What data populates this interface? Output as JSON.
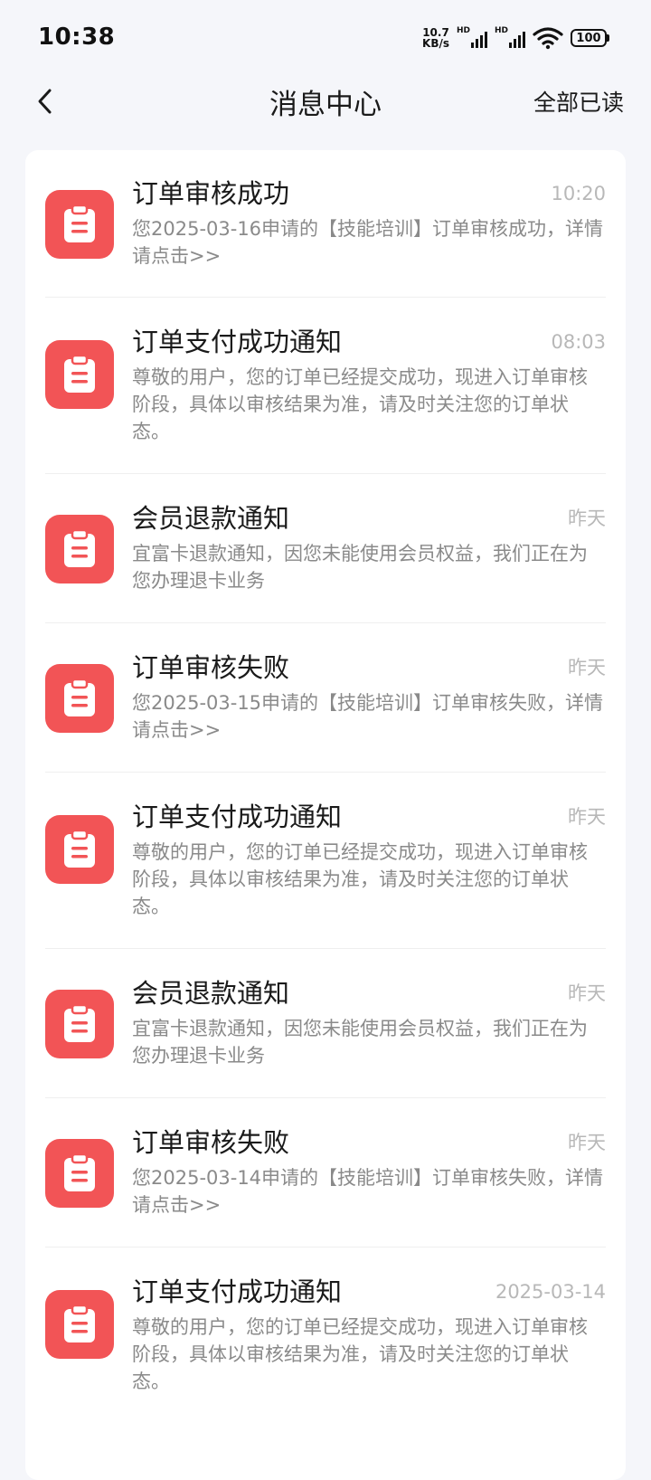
{
  "status_bar": {
    "time": "10:38",
    "net_speed_value": "10.7",
    "net_speed_unit": "KB/s",
    "signal1_label": "HD",
    "signal2_label": "HD",
    "battery": "100"
  },
  "header": {
    "title": "消息中心",
    "read_all": "全部已读"
  },
  "messages": [
    {
      "title": "订单审核成功",
      "time": "10:20",
      "body": "您2025-03-16申请的【技能培训】订单审核成功，详情请点击>>"
    },
    {
      "title": "订单支付成功通知",
      "time": "08:03",
      "body": "尊敬的用户，您的订单已经提交成功，现进入订单审核阶段，具体以审核结果为准，请及时关注您的订单状态。"
    },
    {
      "title": "会员退款通知",
      "time": "昨天",
      "body": "宜富卡退款通知，因您未能使用会员权益，我们正在为您办理退卡业务"
    },
    {
      "title": "订单审核失败",
      "time": "昨天",
      "body": "您2025-03-15申请的【技能培训】订单审核失败，详情请点击>>"
    },
    {
      "title": "订单支付成功通知",
      "time": "昨天",
      "body": "尊敬的用户，您的订单已经提交成功，现进入订单审核阶段，具体以审核结果为准，请及时关注您的订单状态。"
    },
    {
      "title": "会员退款通知",
      "time": "昨天",
      "body": "宜富卡退款通知，因您未能使用会员权益，我们正在为您办理退卡业务"
    },
    {
      "title": "订单审核失败",
      "time": "昨天",
      "body": "您2025-03-14申请的【技能培训】订单审核失败，详情请点击>>"
    },
    {
      "title": "订单支付成功通知",
      "time": "2025-03-14",
      "body": "尊敬的用户，您的订单已经提交成功，现进入订单审核阶段，具体以审核结果为准，请及时关注您的订单状态。"
    }
  ],
  "colors": {
    "icon_bg": "#f25456",
    "page_bg": "#f5f6fa",
    "muted_text": "#8a8a8a"
  },
  "icons": {
    "back": "chevron-left-icon",
    "message": "clipboard-icon",
    "wifi": "wifi-icon",
    "battery": "battery-icon"
  }
}
